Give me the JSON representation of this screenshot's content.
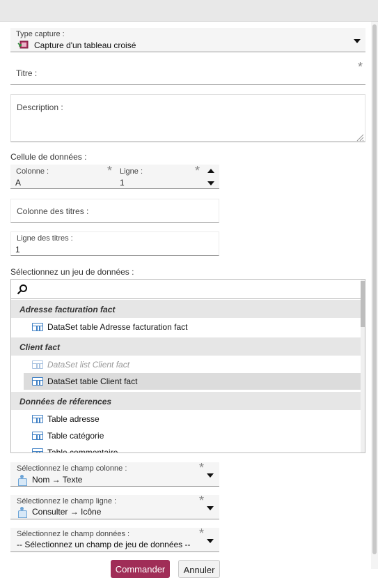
{
  "type_capture": {
    "label": "Type capture :",
    "value": "Capture d'un tableau croisé",
    "icon": "capture-icon"
  },
  "titre": {
    "label": "Titre :",
    "value": ""
  },
  "description": {
    "label": "Description :",
    "value": ""
  },
  "cellule": {
    "title": "Cellule de données :",
    "colonne_label": "Colonne :",
    "colonne_value": "A",
    "ligne_label": "Ligne :",
    "ligne_value": "1"
  },
  "colonne_titres": {
    "label": "Colonne des titres :",
    "value": ""
  },
  "ligne_titres": {
    "label": "Ligne des titres :",
    "value": "1"
  },
  "dataset_section": {
    "title": "Sélectionnez un jeu de données :",
    "groups": [
      {
        "name": "Adresse facturation fact",
        "items": [
          {
            "label": "DataSet table Adresse facturation fact",
            "icon": "table-icon",
            "disabled": false,
            "selected": false
          }
        ]
      },
      {
        "name": "Client fact",
        "items": [
          {
            "label": "DataSet list Client fact",
            "icon": "table-icon",
            "disabled": true,
            "selected": false
          },
          {
            "label": "DataSet table Client fact",
            "icon": "table-icon",
            "disabled": false,
            "selected": true
          }
        ]
      },
      {
        "name": "Données de réferences",
        "items": [
          {
            "label": "Table adresse",
            "icon": "table-icon",
            "disabled": false,
            "selected": false
          },
          {
            "label": "Table catégorie",
            "icon": "table-icon",
            "disabled": false,
            "selected": false
          },
          {
            "label": "Table commentaire",
            "icon": "table-icon",
            "disabled": false,
            "selected": false
          }
        ]
      }
    ]
  },
  "champ_colonne": {
    "label": "Sélectionnez le champ colonne :",
    "value": "Nom → Texte",
    "icon": "field-icon"
  },
  "champ_ligne": {
    "label": "Sélectionnez le champ ligne :",
    "value": "Consulter → Icône",
    "icon": "field-icon"
  },
  "champ_donnees": {
    "label": "Sélectionnez le champ données :",
    "value": "-- Sélectionnez un champ de jeu de données --"
  },
  "buttons": {
    "primary": "Commander",
    "secondary": "Annuler"
  }
}
